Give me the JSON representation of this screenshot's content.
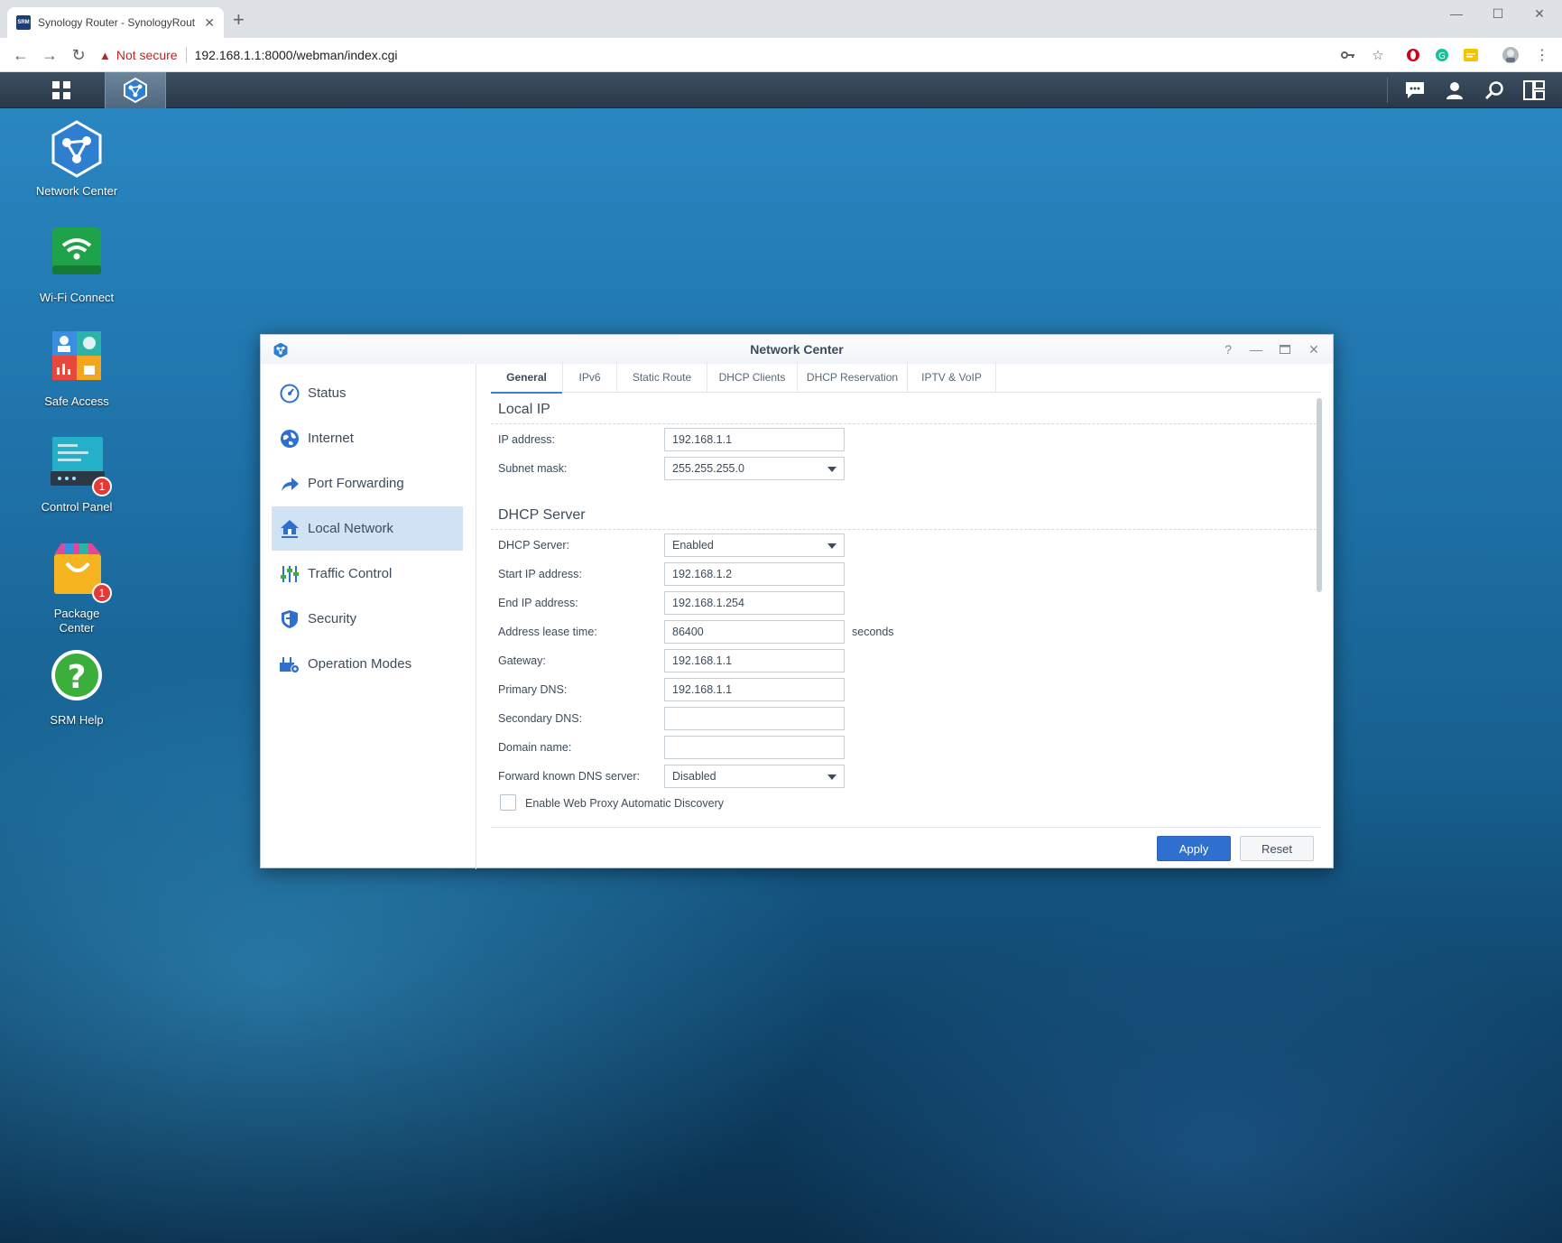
{
  "browser": {
    "tab_title": "Synology Router - SynologyRout",
    "favicon_text": "SRM",
    "security_label": "Not secure",
    "url": "192.168.1.1:8000/webman/index.cgi"
  },
  "desktop": {
    "icons": [
      {
        "label": "Network Center"
      },
      {
        "label": "Wi-Fi Connect"
      },
      {
        "label": "Safe Access"
      },
      {
        "label": "Control Panel",
        "badge": "1"
      },
      {
        "label": "Package Center",
        "badge": "1"
      },
      {
        "label": "SRM Help"
      }
    ]
  },
  "window": {
    "title": "Network Center",
    "sidebar": [
      {
        "label": "Status"
      },
      {
        "label": "Internet"
      },
      {
        "label": "Port Forwarding"
      },
      {
        "label": "Local Network",
        "active": true
      },
      {
        "label": "Traffic Control"
      },
      {
        "label": "Security"
      },
      {
        "label": "Operation Modes"
      }
    ],
    "tabs": [
      {
        "label": "General",
        "active": true
      },
      {
        "label": "IPv6"
      },
      {
        "label": "Static Route"
      },
      {
        "label": "DHCP Clients"
      },
      {
        "label": "DHCP Reservation"
      },
      {
        "label": "IPTV & VoIP"
      }
    ],
    "local_ip": {
      "heading": "Local IP",
      "ip_label": "IP address:",
      "ip_value": "192.168.1.1",
      "subnet_label": "Subnet mask:",
      "subnet_value": "255.255.255.0"
    },
    "dhcp": {
      "heading": "DHCP Server",
      "server_label": "DHCP Server:",
      "server_value": "Enabled",
      "start_label": "Start IP address:",
      "start_value": "192.168.1.2",
      "end_label": "End IP address:",
      "end_value": "192.168.1.254",
      "lease_label": "Address lease time:",
      "lease_value": "86400",
      "lease_unit": "seconds",
      "gateway_label": "Gateway:",
      "gateway_value": "192.168.1.1",
      "primary_dns_label": "Primary DNS:",
      "primary_dns_value": "192.168.1.1",
      "secondary_dns_label": "Secondary DNS:",
      "secondary_dns_value": "",
      "domain_label": "Domain name:",
      "domain_value": "",
      "forward_label": "Forward known DNS server:",
      "forward_value": "Disabled",
      "wpad_label": "Enable Web Proxy Automatic Discovery"
    },
    "buttons": {
      "apply": "Apply",
      "reset": "Reset"
    }
  },
  "colors": {
    "accent": "#2f6fd0",
    "badge": "#e53935",
    "sidebar_active": "#cfe3f5"
  }
}
